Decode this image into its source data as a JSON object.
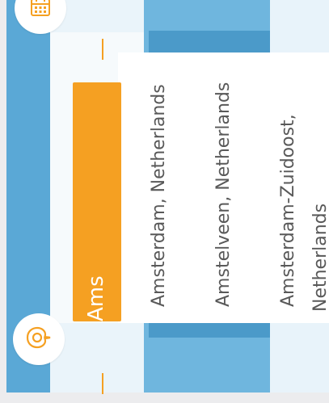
{
  "search": {
    "query": "Ams"
  },
  "suggestions": [
    {
      "label": "Amsterdam, Netherlands"
    },
    {
      "label": "Amstelveen, Netherlands"
    },
    {
      "label_line1": "Amsterdam-Zuidoost,",
      "label_line2": "Netherlands"
    }
  ],
  "icons": {
    "top": "calendar-icon",
    "bottom": "location-pin-icon"
  },
  "colors": {
    "accent": "#f5a022",
    "primary": "#6fb6de",
    "text": "#595959"
  }
}
